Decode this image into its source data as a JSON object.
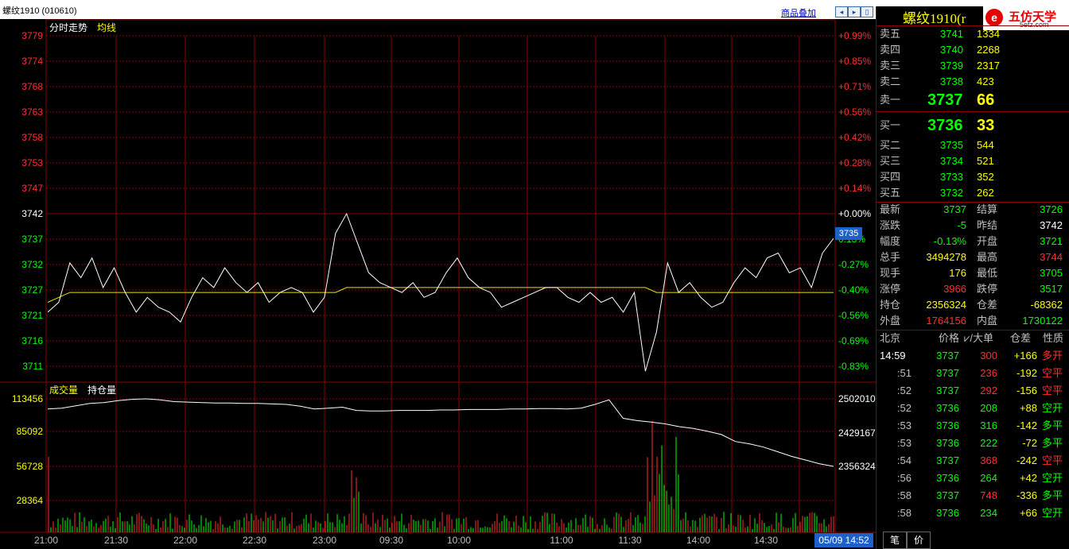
{
  "window": {
    "title": "螺纹1910 (010610)",
    "overlay_link": "商品叠加",
    "nav_buttons": [
      "arrow-left-icon",
      "arrow-right-icon",
      "panel-icon"
    ],
    "symbol_title": "螺纹1910(r",
    "logo_text": "五仿天学",
    "logo_url": "5etz.com",
    "logo_mark": "e"
  },
  "price_chart": {
    "label": "分时走势",
    "avg_label": "均线",
    "left_ticks": [
      "3779",
      "3774",
      "3768",
      "3763",
      "3758",
      "3753",
      "3747",
      "3742",
      "3737",
      "3732",
      "3727",
      "3721",
      "3716",
      "3711"
    ],
    "right_ticks": [
      "+0.99%",
      "+0.85%",
      "+0.71%",
      "+0.56%",
      "+0.42%",
      "+0.28%",
      "+0.14%",
      "+0.00%",
      "0.13%",
      "-0.27%",
      "-0.40%",
      "-0.56%",
      "-0.69%",
      "-0.83%"
    ],
    "current_price_tag": "3735"
  },
  "volume_chart": {
    "label": "成交量",
    "oi_label": "持仓量",
    "left_ticks": [
      "113456",
      "85092",
      "56728",
      "28364"
    ],
    "right_ticks": [
      "2502010",
      "2429167",
      "2356324"
    ]
  },
  "time_axis": [
    "21:00",
    "21:30",
    "22:00",
    "22:30",
    "23:00",
    "09:30",
    "10:00",
    "11:00",
    "11:30",
    "14:00",
    "14:30"
  ],
  "time_box": "05/09 14:52",
  "order_book": {
    "asks": [
      {
        "label": "卖五",
        "price": "3741",
        "vol": "1334"
      },
      {
        "label": "卖四",
        "price": "3740",
        "vol": "2268"
      },
      {
        "label": "卖三",
        "price": "3739",
        "vol": "2317"
      },
      {
        "label": "卖二",
        "price": "3738",
        "vol": "423"
      },
      {
        "label": "卖一",
        "price": "3737",
        "vol": "66"
      }
    ],
    "bids": [
      {
        "label": "买一",
        "price": "3736",
        "vol": "33"
      },
      {
        "label": "买二",
        "price": "3735",
        "vol": "544"
      },
      {
        "label": "买三",
        "price": "3734",
        "vol": "521"
      },
      {
        "label": "买四",
        "price": "3733",
        "vol": "352"
      },
      {
        "label": "买五",
        "price": "3732",
        "vol": "262"
      }
    ]
  },
  "stats": [
    {
      "l1": "最新",
      "v1": "3737",
      "c1": "green",
      "l2": "结算",
      "v2": "3726",
      "c2": "green"
    },
    {
      "l1": "涨跌",
      "v1": "-5",
      "c1": "green",
      "l2": "昨结",
      "v2": "3742",
      "c2": "white"
    },
    {
      "l1": "幅度",
      "v1": "-0.13%",
      "c1": "green",
      "l2": "开盘",
      "v2": "3721",
      "c2": "green"
    },
    {
      "l1": "总手",
      "v1": "3494278",
      "c1": "yellow",
      "l2": "最高",
      "v2": "3744",
      "c2": "red"
    },
    {
      "l1": "现手",
      "v1": "176",
      "c1": "yellow",
      "l2": "最低",
      "v2": "3705",
      "c2": "green"
    },
    {
      "l1": "涨停",
      "v1": "3966",
      "c1": "red",
      "l2": "跌停",
      "v2": "3517",
      "c2": "green"
    },
    {
      "l1": "持仓",
      "v1": "2356324",
      "c1": "yellow",
      "l2": "仓差",
      "v2": "-68362",
      "c2": "yellow"
    },
    {
      "l1": "外盘",
      "v1": "1764156",
      "c1": "red",
      "l2": "内盘",
      "v2": "1730122",
      "c2": "green"
    }
  ],
  "ticks_header": {
    "time": "北京",
    "price": "价格",
    "vol": "⩗/大单",
    "oi": "仓差",
    "nature": "性质"
  },
  "ticks": [
    {
      "time": "14:59",
      "price": "3737",
      "vol": "300",
      "oi": "+166",
      "nature": "多开",
      "pc": "green",
      "vc": "red",
      "oc": "yellow",
      "nc": "red"
    },
    {
      "time": ":51",
      "price": "3737",
      "vol": "236",
      "oi": "-192",
      "nature": "空平",
      "pc": "green",
      "vc": "red",
      "oc": "yellow",
      "nc": "red"
    },
    {
      "time": ":52",
      "price": "3737",
      "vol": "292",
      "oi": "-156",
      "nature": "空平",
      "pc": "green",
      "vc": "red",
      "oc": "yellow",
      "nc": "red"
    },
    {
      "time": ":52",
      "price": "3736",
      "vol": "208",
      "oi": "+88",
      "nature": "空开",
      "pc": "green",
      "vc": "green",
      "oc": "yellow",
      "nc": "green"
    },
    {
      "time": ":53",
      "price": "3736",
      "vol": "316",
      "oi": "-142",
      "nature": "多平",
      "pc": "green",
      "vc": "green",
      "oc": "yellow",
      "nc": "green"
    },
    {
      "time": ":53",
      "price": "3736",
      "vol": "222",
      "oi": "-72",
      "nature": "多平",
      "pc": "green",
      "vc": "green",
      "oc": "yellow",
      "nc": "green"
    },
    {
      "time": ":54",
      "price": "3737",
      "vol": "368",
      "oi": "-242",
      "nature": "空平",
      "pc": "green",
      "vc": "red",
      "oc": "yellow",
      "nc": "red"
    },
    {
      "time": ":56",
      "price": "3736",
      "vol": "264",
      "oi": "+42",
      "nature": "空开",
      "pc": "green",
      "vc": "green",
      "oc": "yellow",
      "nc": "green"
    },
    {
      "time": ":58",
      "price": "3737",
      "vol": "748",
      "oi": "-336",
      "nature": "多平",
      "pc": "green",
      "vc": "red",
      "oc": "yellow",
      "nc": "green"
    },
    {
      "time": ":58",
      "price": "3736",
      "vol": "234",
      "oi": "+66",
      "nature": "空开",
      "pc": "green",
      "vc": "green",
      "oc": "yellow",
      "nc": "green"
    }
  ],
  "bottom_tabs": [
    "笔",
    "价"
  ],
  "colors": {
    "grid": "#8b0000",
    "price_line": "#ffffff",
    "avg_line": "#e6e600",
    "up": "#ff3030",
    "down": "#00ff00",
    "accent": "#1e60c8"
  },
  "chart_data": {
    "type": "line",
    "series": [
      {
        "name": "分时走势",
        "values": [
          3722,
          3724,
          3732,
          3729,
          3733,
          3727,
          3731,
          3726,
          3722,
          3725,
          3723,
          3722,
          3720,
          3725,
          3729,
          3727,
          3731,
          3728,
          3726,
          3728,
          3724,
          3726,
          3727,
          3726,
          3722,
          3725,
          3738,
          3742,
          3736,
          3730,
          3728,
          3727,
          3726,
          3728,
          3725,
          3726,
          3730,
          3733,
          3729,
          3727,
          3726,
          3723,
          3724,
          3725,
          3726,
          3727,
          3727,
          3725,
          3724,
          3726,
          3724,
          3725,
          3722,
          3726,
          3710,
          3718,
          3732,
          3726,
          3728,
          3725,
          3723,
          3724,
          3728,
          3731,
          3729,
          3733,
          3734,
          3730,
          3731,
          3727,
          3734,
          3737
        ]
      },
      {
        "name": "均线",
        "values": [
          3724,
          3725,
          3726,
          3726,
          3726,
          3726,
          3726,
          3726,
          3726,
          3726,
          3726,
          3726,
          3726,
          3726,
          3726,
          3726,
          3726,
          3726,
          3726,
          3726,
          3726,
          3726,
          3726,
          3726,
          3726,
          3726,
          3726,
          3727,
          3727,
          3727,
          3727,
          3727,
          3727,
          3727,
          3727,
          3727,
          3727,
          3727,
          3727,
          3727,
          3727,
          3727,
          3727,
          3727,
          3727,
          3727,
          3727,
          3727,
          3727,
          3727,
          3727,
          3727,
          3727,
          3727,
          3727,
          3726,
          3726,
          3726,
          3726,
          3726,
          3726,
          3726,
          3726,
          3726,
          3726,
          3726,
          3726,
          3726,
          3726,
          3726,
          3726,
          3726
        ]
      },
      {
        "name": "持仓量",
        "values": [
          2480000,
          2482000,
          2487000,
          2492000,
          2494000,
          2498000,
          2501000,
          2502000,
          2500000,
          2496000,
          2495000,
          2494000,
          2493000,
          2493000,
          2492000,
          2492000,
          2491000,
          2490000,
          2486000,
          2480000,
          2482000,
          2484000,
          2477000,
          2476000,
          2476000,
          2477000,
          2477000,
          2477000,
          2478000,
          2478000,
          2479000,
          2479000,
          2479000,
          2480000,
          2480000,
          2481000,
          2481000,
          2480000,
          2482000,
          2490000,
          2500000,
          2460000,
          2455000,
          2452000,
          2448000,
          2442000,
          2438000,
          2432000,
          2425000,
          2410000,
          2405000,
          2398000,
          2388000,
          2378000,
          2370000,
          2362000,
          2356324
        ]
      }
    ],
    "ylim": [
      3708,
      3780
    ]
  }
}
